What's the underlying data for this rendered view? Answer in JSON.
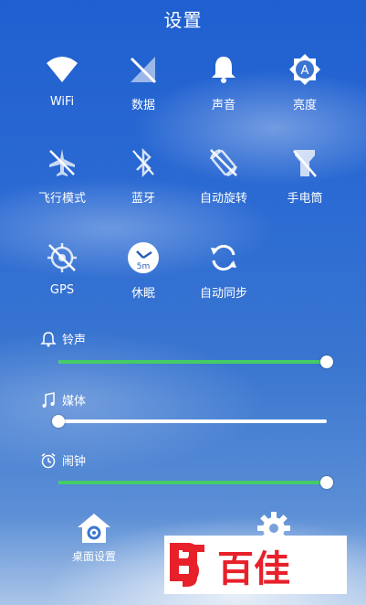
{
  "header": {
    "title": "设置"
  },
  "toggles": [
    {
      "label": "WiFi",
      "icon": "wifi-icon"
    },
    {
      "label": "数据",
      "icon": "mobile-data-off-icon"
    },
    {
      "label": "声音",
      "icon": "bell-icon"
    },
    {
      "label": "亮度",
      "icon": "auto-brightness-icon"
    },
    {
      "label": "飞行模式",
      "icon": "airplane-icon"
    },
    {
      "label": "蓝牙",
      "icon": "bluetooth-icon"
    },
    {
      "label": "自动旋转",
      "icon": "auto-rotate-off-icon"
    },
    {
      "label": "手电筒",
      "icon": "flashlight-icon"
    },
    {
      "label": "GPS",
      "icon": "gps-off-icon"
    },
    {
      "label": "休眠",
      "icon": "sleep-timer-icon",
      "badge": "5m"
    },
    {
      "label": "自动同步",
      "icon": "sync-icon"
    }
  ],
  "sliders": [
    {
      "label": "铃声",
      "icon": "bell-outline-icon",
      "level": 1.0
    },
    {
      "label": "媒体",
      "icon": "music-note-icon",
      "level": 0.0
    },
    {
      "label": "闹钟",
      "icon": "alarm-clock-icon",
      "level": 1.0
    }
  ],
  "bottom": {
    "home_settings_label": "桌面设置"
  },
  "watermark": {
    "text": "百佳"
  },
  "colors": {
    "slider_fill": "#44cc66",
    "logo_red": "#e8202a"
  }
}
